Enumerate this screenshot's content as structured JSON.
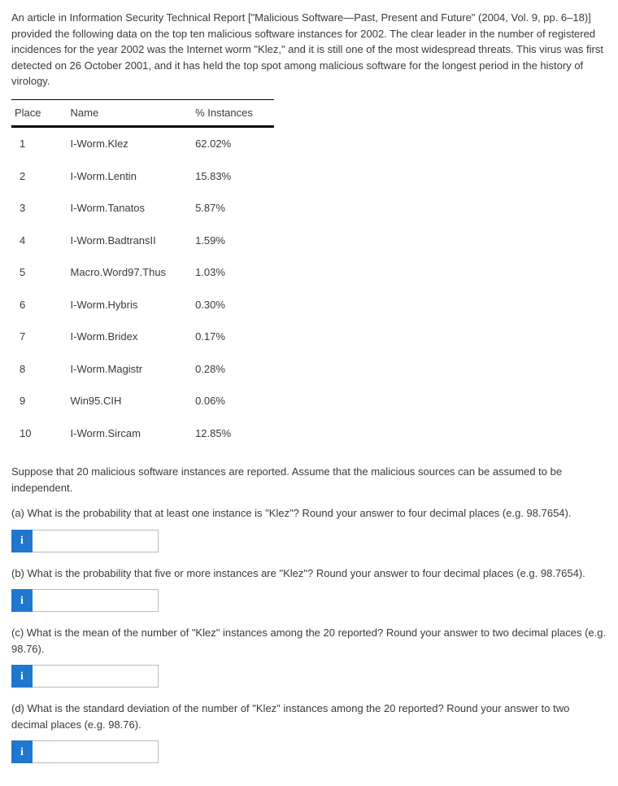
{
  "intro": "An article in Information Security Technical Report [\"Malicious Software—Past, Present and Future\" (2004, Vol. 9, pp. 6–18)] provided the following data on the top ten malicious software instances for 2002. The clear leader in the number of registered incidences for the year 2002 was the Internet worm \"Klez,\" and it is still one of the most widespread threats. This virus was first detected on 26 October 2001, and it has held the top spot among malicious software for the longest period in the history of virology.",
  "table": {
    "headers": {
      "place": "Place",
      "name": "Name",
      "pct": "% Instances"
    },
    "rows": [
      {
        "place": "1",
        "name": "I-Worm.Klez",
        "pct": "62.02%"
      },
      {
        "place": "2",
        "name": "I-Worm.Lentin",
        "pct": "15.83%"
      },
      {
        "place": "3",
        "name": "I-Worm.Tanatos",
        "pct": "5.87%"
      },
      {
        "place": "4",
        "name": "I-Worm.BadtransII",
        "pct": "1.59%"
      },
      {
        "place": "5",
        "name": "Macro.Word97.Thus",
        "pct": "1.03%"
      },
      {
        "place": "6",
        "name": "I-Worm.Hybris",
        "pct": "0.30%"
      },
      {
        "place": "7",
        "name": "I-Worm.Bridex",
        "pct": "0.17%"
      },
      {
        "place": "8",
        "name": "I-Worm.Magistr",
        "pct": "0.28%"
      },
      {
        "place": "9",
        "name": "Win95.CIH",
        "pct": "0.06%"
      },
      {
        "place": "10",
        "name": "I-Worm.Sircam",
        "pct": "12.85%"
      }
    ]
  },
  "suppose": "Suppose that 20 malicious software instances are reported. Assume that the malicious sources can be assumed to be independent.",
  "questions": {
    "a": "(a) What is the probability that at least one instance is \"Klez\"? Round your answer to four decimal places (e.g. 98.7654).",
    "b": "(b) What is the probability that five or more instances are \"Klez\"? Round your answer to four decimal places (e.g. 98.7654).",
    "c": "(c) What is the mean of the number of \"Klez\" instances among the 20 reported? Round your answer to two decimal places (e.g. 98.76).",
    "d": "(d) What is the standard deviation of the number of \"Klez\" instances among the 20 reported? Round your answer to two decimal places (e.g. 98.76)."
  },
  "icons": {
    "info": "i"
  },
  "inputs": {
    "a": "",
    "b": "",
    "c": "",
    "d": ""
  }
}
